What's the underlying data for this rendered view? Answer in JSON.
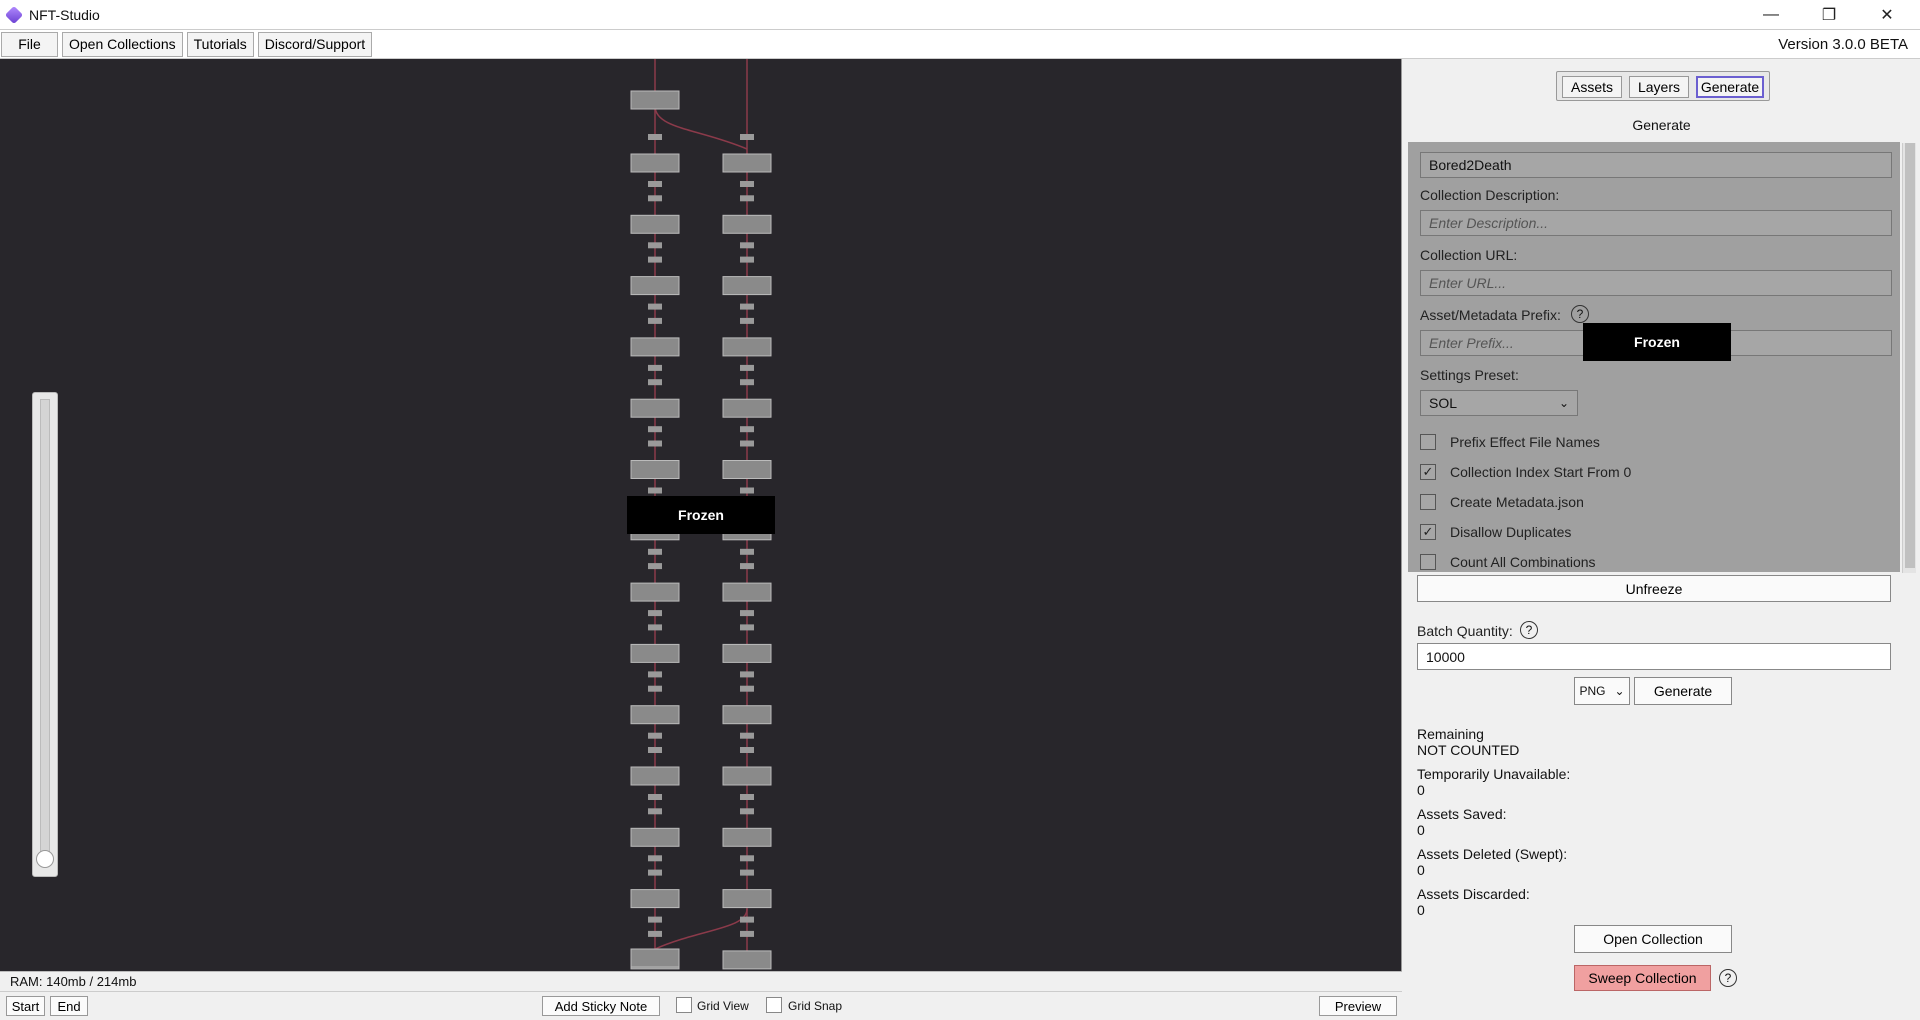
{
  "window": {
    "title": "NFT-Studio"
  },
  "menu": {
    "file": "File",
    "open_collections": "Open Collections",
    "tutorials": "Tutorials",
    "discord": "Discord/Support",
    "version": "Version 3.0.0 BETA"
  },
  "canvas": {
    "frozen_label": "Frozen"
  },
  "status": {
    "ram": "RAM: 140mb / 214mb"
  },
  "bottom": {
    "start": "Start",
    "end": "End",
    "add_sticky": "Add Sticky Note",
    "grid_view": "Grid View",
    "grid_snap": "Grid Snap",
    "preview": "Preview"
  },
  "tabs": {
    "assets": "Assets",
    "layers": "Layers",
    "generate": "Generate"
  },
  "panel": {
    "heading": "Generate",
    "collection_name": "Bored2Death",
    "desc_label": "Collection Description:",
    "desc_placeholder": "Enter Description...",
    "url_label": "Collection URL:",
    "url_placeholder": "Enter URL...",
    "prefix_label": "Asset/Metadata Prefix:",
    "prefix_placeholder": "Enter Prefix...",
    "frozen_label": "Frozen",
    "preset_label": "Settings Preset:",
    "preset_value": "SOL",
    "options": [
      {
        "label": "Prefix Effect File Names",
        "checked": false
      },
      {
        "label": "Collection Index Start From 0",
        "checked": true
      },
      {
        "label": "Create Metadata.json",
        "checked": false
      },
      {
        "label": "Disallow Duplicates",
        "checked": true
      },
      {
        "label": "Count All Combinations",
        "checked": false
      }
    ],
    "unfreeze": "Unfreeze",
    "batch_label": "Batch Quantity:",
    "batch_value": "10000",
    "format": "PNG",
    "generate_button": "Generate",
    "help": "?",
    "check_mark": "✓",
    "stats": {
      "remaining_label": "Remaining",
      "remaining_value": "NOT COUNTED",
      "temp_label": "Temporarily Unavailable:",
      "temp_value": "0",
      "saved_label": "Assets Saved:",
      "saved_value": "0",
      "deleted_label": "Assets Deleted (Swept):",
      "deleted_value": "0",
      "discarded_label": "Assets Discarded:",
      "discarded_value": "0"
    },
    "open_collection": "Open Collection",
    "sweep_collection": "Sweep Collection"
  },
  "colors": {
    "canvas_bg": "#28262b",
    "frozen_bg": "#000000",
    "sweep_bg": "#f0a0a0",
    "tab_active": "#6b5fd0"
  }
}
